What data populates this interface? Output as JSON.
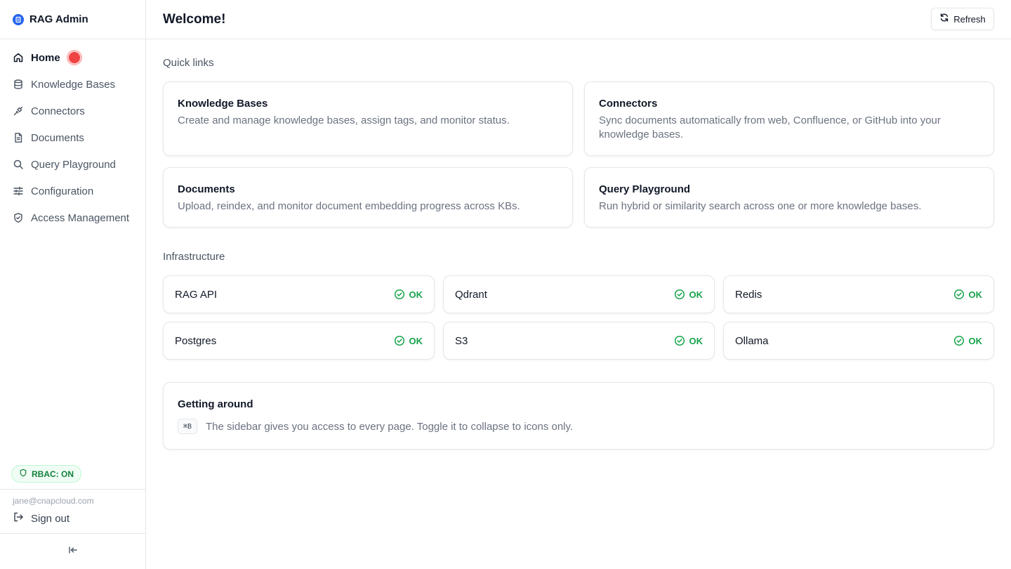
{
  "app": {
    "title": "RAG Admin"
  },
  "sidebar": {
    "items": [
      {
        "label": "Home",
        "icon": "home-icon",
        "active": true
      },
      {
        "label": "Knowledge Bases",
        "icon": "database-icon"
      },
      {
        "label": "Connectors",
        "icon": "plug-icon"
      },
      {
        "label": "Documents",
        "icon": "document-icon"
      },
      {
        "label": "Query Playground",
        "icon": "search-icon"
      },
      {
        "label": "Configuration",
        "icon": "sliders-icon"
      },
      {
        "label": "Access Management",
        "icon": "shield-icon"
      }
    ],
    "rbac_label": "RBAC: ON",
    "user_email": "jane@cnapcloud.com",
    "signout_label": "Sign out"
  },
  "header": {
    "title": "Welcome!",
    "refresh_label": "Refresh"
  },
  "quick_links": {
    "title": "Quick links",
    "cards": [
      {
        "title": "Knowledge Bases",
        "description": "Create and manage knowledge bases, assign tags, and monitor status."
      },
      {
        "title": "Connectors",
        "description": "Sync documents automatically from web, Confluence, or GitHub into your knowledge bases."
      },
      {
        "title": "Documents",
        "description": "Upload, reindex, and monitor document embedding progress across KBs."
      },
      {
        "title": "Query Playground",
        "description": "Run hybrid or similarity search across one or more knowledge bases."
      }
    ]
  },
  "infrastructure": {
    "title": "Infrastructure",
    "services": [
      {
        "name": "RAG API",
        "status": "OK"
      },
      {
        "name": "Qdrant",
        "status": "OK"
      },
      {
        "name": "Redis",
        "status": "OK"
      },
      {
        "name": "Postgres",
        "status": "OK"
      },
      {
        "name": "S3",
        "status": "OK"
      },
      {
        "name": "Ollama",
        "status": "OK"
      }
    ]
  },
  "getting_around": {
    "title": "Getting around",
    "shortcut": "⌘B",
    "description": "The sidebar gives you access to every page. Toggle it to collapse to icons only."
  },
  "colors": {
    "accent": "#2563eb",
    "ok": "#16a34a",
    "notification": "#ef4444"
  }
}
